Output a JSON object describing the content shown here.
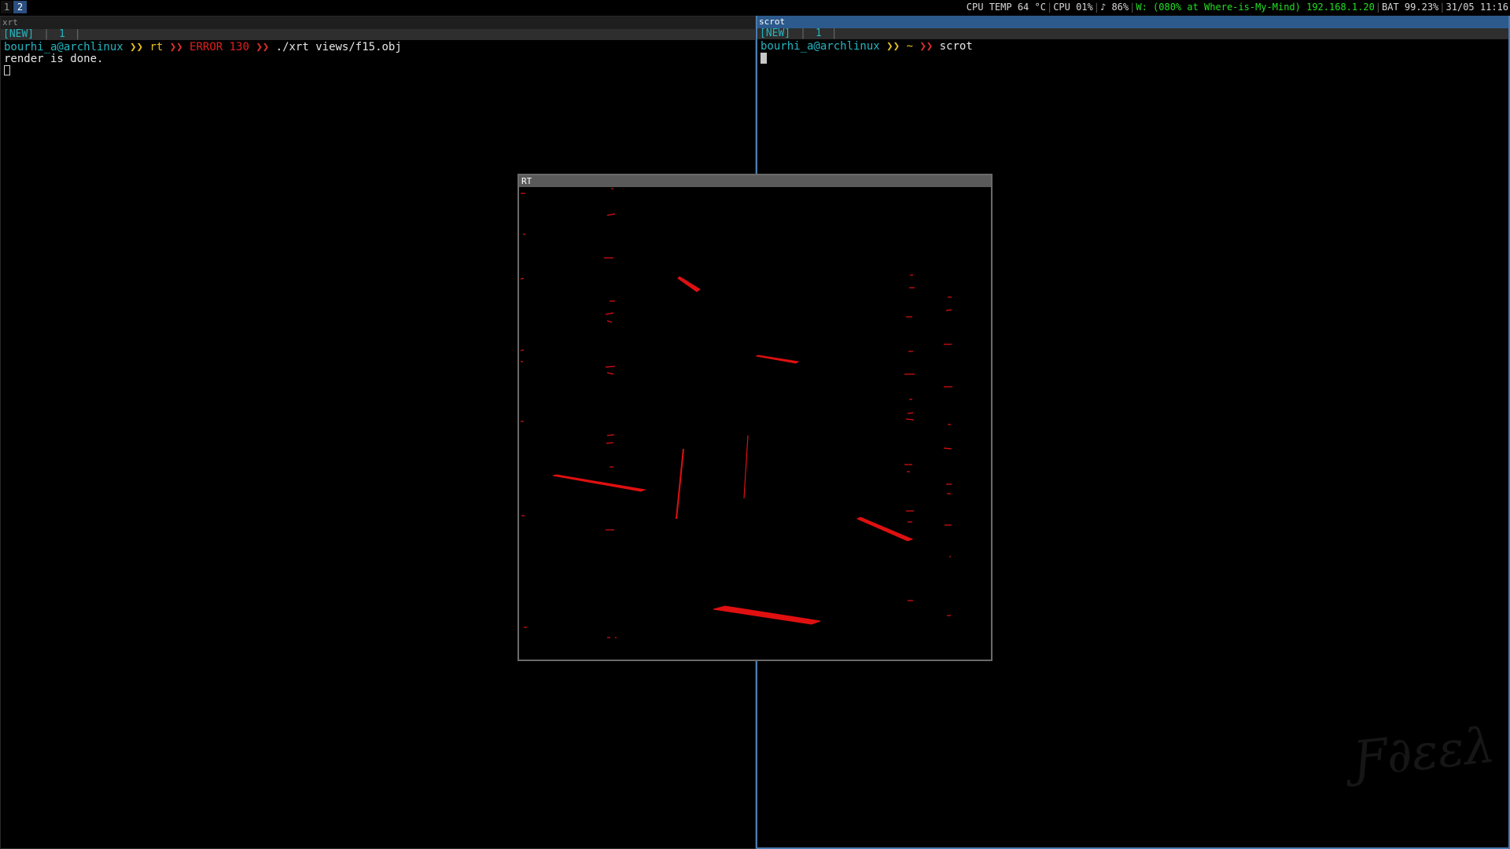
{
  "topbar": {
    "workspaces": [
      {
        "label": "1",
        "active": false
      },
      {
        "label": "2",
        "active": true
      }
    ],
    "status": {
      "cpu_temp": "CPU TEMP 64 °C",
      "cpu": "CPU 01%",
      "volume": "♪ 86%",
      "wifi": "W: (080% at Where-is-My-Mind) 192.168.1.20",
      "battery": "BAT 99.23%",
      "datetime": "31/05 11:16",
      "separator": "|"
    }
  },
  "left_terminal": {
    "title": "xrt",
    "tabs": {
      "new_label": "[NEW]",
      "tab_number": "1",
      "separator": "|"
    },
    "prompt": {
      "user": "bourhi_a@archlinux",
      "arrow": "❯❯",
      "dir": "rt",
      "error": "ERROR 130",
      "command": "./xrt views/f15.obj"
    },
    "output": "render is done."
  },
  "right_terminal": {
    "title": "scrot",
    "tabs": {
      "new_label": "[NEW]",
      "tab_number": "1",
      "separator": "|"
    },
    "prompt": {
      "user": "bourhi_a@archlinux",
      "arrow": "❯❯",
      "dir": "~",
      "command": "scrot"
    }
  },
  "rt_window": {
    "title": "RT"
  },
  "colors": {
    "render": "#e01010",
    "accent_blue": "#2c5a8c",
    "prompt_cyan": "#25b5c0",
    "prompt_yellow": "#e6c020",
    "error_red": "#e02020",
    "wifi_green": "#22e022"
  }
}
